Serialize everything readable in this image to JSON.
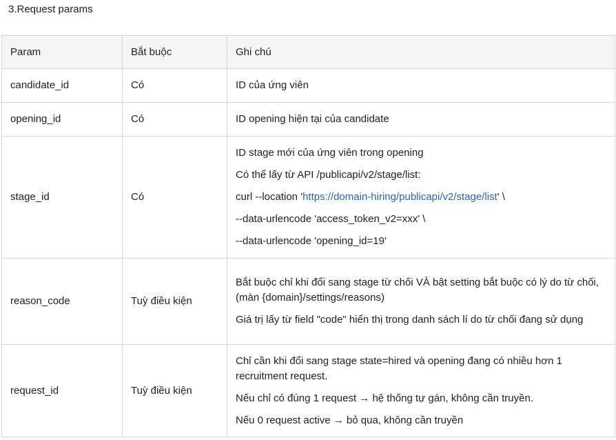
{
  "heading": "3.Request params",
  "columns": {
    "param": "Param",
    "required": "Bắt buộc",
    "note": "Ghi chú"
  },
  "rows": [
    {
      "param": "candidate_id",
      "required": "Có",
      "note": [
        "ID của ứng viên"
      ]
    },
    {
      "param": "opening_id",
      "required": "Có",
      "note": [
        "ID opening hiện tại của candidate"
      ]
    },
    {
      "param": "stage_id",
      "required": "Có",
      "note": [
        "ID stage mới của ứng viên trong opening",
        "Có thể lấy từ API /publicapi/v2/stage/list:"
      ],
      "curl": {
        "prefix": "curl --location '",
        "url": "https://domain-hiring/publicapi/v2/stage/list",
        "suffix": "' \\",
        "line2": "--data-urlencode 'access_token_v2=xxx' \\",
        "line3": "--data-urlencode 'opening_id=19'"
      }
    },
    {
      "param": "reason_code",
      "required": "Tuỳ điều kiện",
      "note": [
        "Bắt buộc chỉ khi đổi sang stage từ chối VÀ bật setting bắt buộc có lý do từ chối, (màn {domain}/settings/reasons)",
        "Giá trị lấy từ field \"code\" hiển thị trong danh sách lí do từ chối đang sử dụng"
      ]
    },
    {
      "param": "request_id",
      "required": "Tuỳ điều kiện",
      "note": [
        "Chỉ cần khi đổi sang stage state=hired và opening đang có nhiều hơn 1 recruitment request.",
        "Nếu chỉ có đúng 1 request → hệ thống tự gán, không cần truyền.",
        "Nếu 0 request active → bỏ qua, không cần truyền"
      ]
    }
  ]
}
